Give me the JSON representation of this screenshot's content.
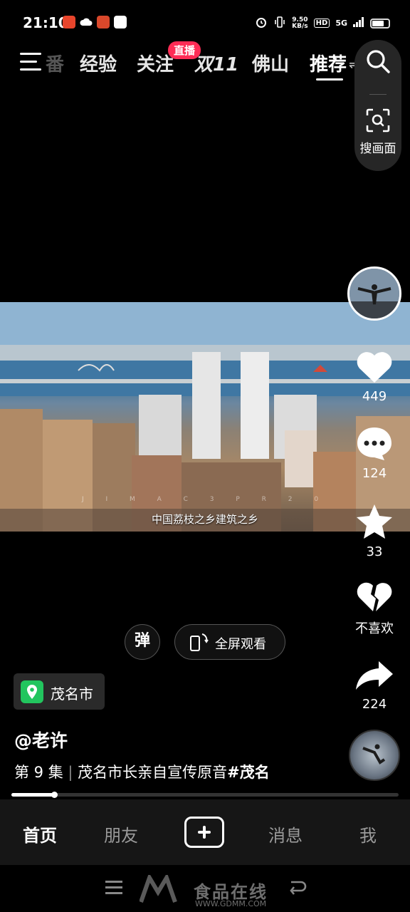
{
  "status_bar": {
    "time": "21:10",
    "net_speed_value": "9.50",
    "net_speed_unit": "KB/s",
    "hd": "HD",
    "network": "5G"
  },
  "top_tabs": {
    "partial_left": "番",
    "items": [
      "经验",
      "关注",
      "双11",
      "佛山",
      "推荐"
    ],
    "active": "推荐",
    "live_badge": "直播"
  },
  "search": {
    "image_search_label": "搜画面"
  },
  "video": {
    "subtitle": "中国荔枝之乡建筑之乡",
    "faint_text": "J I M A C 3 P R 2 0"
  },
  "actions": {
    "likes": "449",
    "comments": "124",
    "favorites": "33",
    "dislike_label": "不喜欢",
    "shares": "224"
  },
  "controls": {
    "danmu_label": "弹",
    "fullscreen_label": "全屏观看"
  },
  "location": {
    "label": "茂名市"
  },
  "post": {
    "author": "@老许",
    "episode": "第 9 集",
    "title": "茂名市长亲自宣传原音",
    "hashtag": "#茂名"
  },
  "playback": {
    "progress": 0.11
  },
  "bottom_nav": {
    "home": "首页",
    "friends": "朋友",
    "messages": "消息",
    "me": "我"
  },
  "watermark": {
    "text": "食品在线",
    "url": "WWW.GDMM.COM"
  },
  "colors": {
    "accent": "#fe2c55",
    "location_pin": "#22c55e",
    "background": "#000000"
  }
}
